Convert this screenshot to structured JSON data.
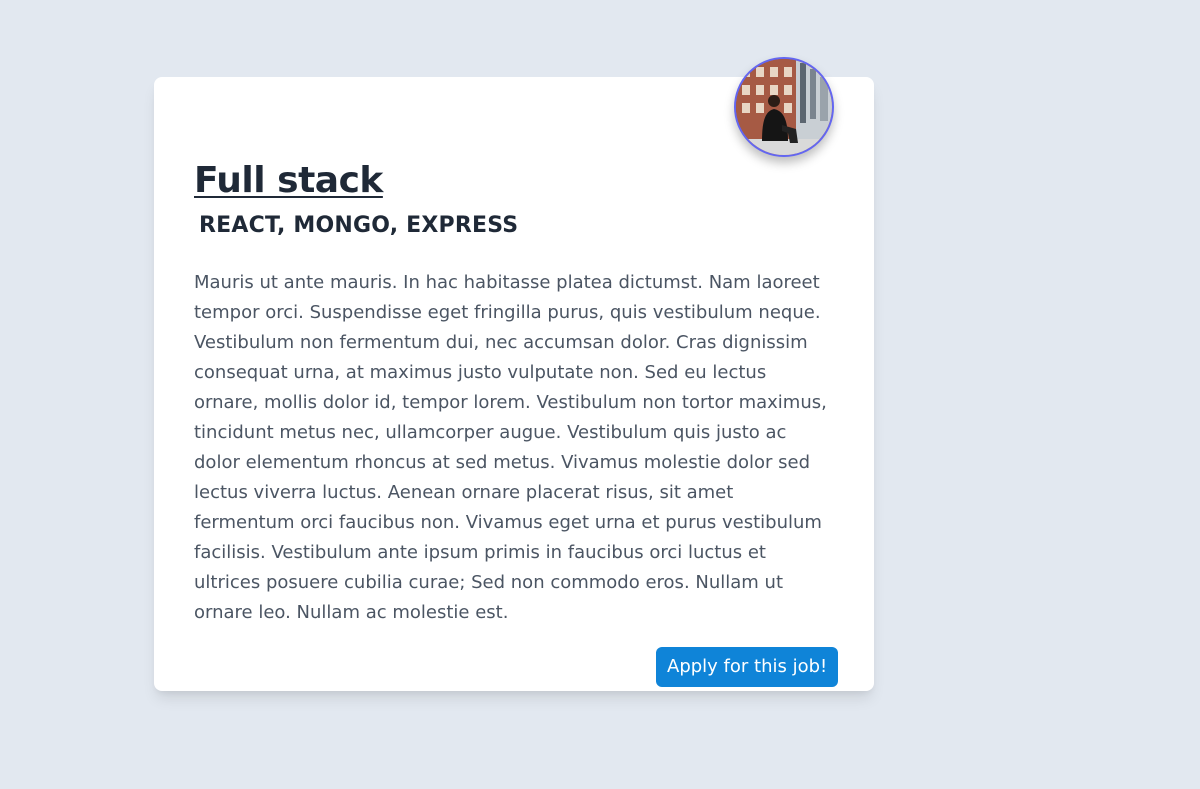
{
  "job": {
    "title": "Full stack",
    "stack": "REACT, MONGO, EXPRESS",
    "description": "Mauris ut ante mauris. In hac habitasse platea dictumst. Nam laoreet tempor orci. Suspendisse eget fringilla purus, quis vestibulum neque. Vestibulum non fermentum dui, nec accumsan dolor. Cras dignissim consequat urna, at maximus justo vulputate non. Sed eu lectus ornare, mollis dolor id, tempor lorem. Vestibulum non tortor maximus, tincidunt metus nec, ullamcorper augue. Vestibulum quis justo ac dolor elementum rhoncus at sed metus. Vivamus molestie dolor sed lectus viverra luctus. Aenean ornare placerat risus, sit amet fermentum orci faucibus non. Vivamus eget urna et purus vestibulum facilisis. Vestibulum ante ipsum primis in faucibus orci luctus et ultrices posuere cubilia curae; Sed non commodo eros. Nullam ut ornare leo. Nullam ac molestie est.",
    "apply_label": "Apply for this job!"
  },
  "colors": {
    "background": "#e2e8f0",
    "card": "#ffffff",
    "avatar_border": "#6366f1",
    "button": "#0f84d8",
    "heading": "#1f2937",
    "body_text": "#4b5563"
  },
  "icons": {
    "avatar": "person-photo-avatar"
  }
}
